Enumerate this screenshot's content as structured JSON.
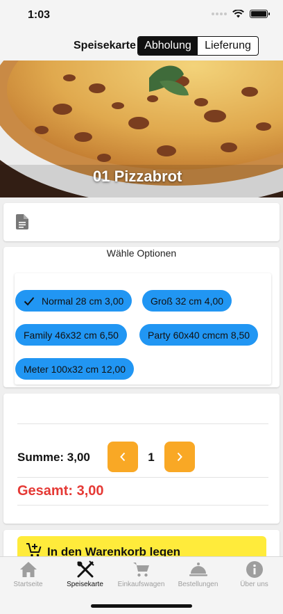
{
  "status_bar": {
    "time": "1:03"
  },
  "nav": {
    "title": "Speisekarte",
    "segments": [
      {
        "label": "Abholung",
        "active": true
      },
      {
        "label": "Lieferung",
        "active": false
      }
    ]
  },
  "product": {
    "title": "01 Pizzabrot"
  },
  "options": {
    "title": "Wähle Optionen",
    "choices": [
      {
        "label": "Normal 28 cm 3,00",
        "selected": true
      },
      {
        "label": "Groß 32 cm 4,00",
        "selected": false
      },
      {
        "label": "Family 46x32 cm 6,50",
        "selected": false
      },
      {
        "label": "Party 60x40 cmcm 8,50",
        "selected": false
      },
      {
        "label": "Meter 100x32 cm 12,00",
        "selected": false
      }
    ]
  },
  "summary": {
    "sum_label": "Summe: 3,00",
    "quantity": "1",
    "total_label": "Gesamt: 3,00"
  },
  "cart": {
    "label": "In den Warenkorb legen"
  },
  "tabs": [
    {
      "label": "Startseite",
      "icon": "home-icon",
      "active": false
    },
    {
      "label": "Speisekarte",
      "icon": "cutlery-icon",
      "active": true
    },
    {
      "label": "Einkaufswagen",
      "icon": "cart-icon",
      "active": false
    },
    {
      "label": "Bestellungen",
      "icon": "cloche-icon",
      "active": false
    },
    {
      "label": "Über uns",
      "icon": "info-icon",
      "active": false
    }
  ],
  "colors": {
    "chip": "#2196f3",
    "quantity_button": "#f9a825",
    "total": "#e53935",
    "cart_button": "#ffeb3b"
  }
}
